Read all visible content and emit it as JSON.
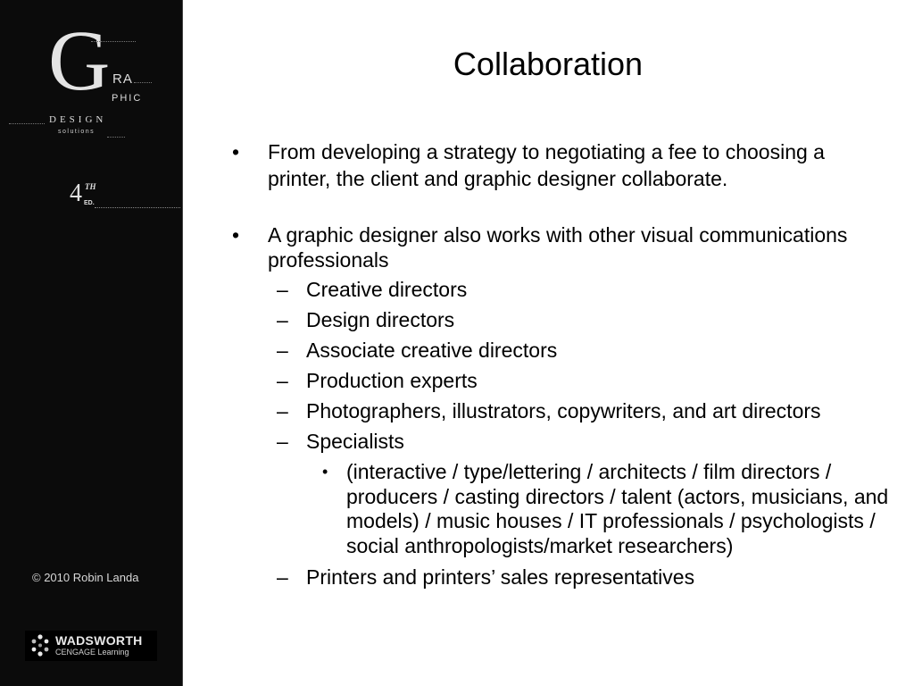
{
  "slide": {
    "title": "Collaboration",
    "bullets": [
      "From developing a strategy to negotiating a fee to choosing a printer, the client and graphic designer collaborate.",
      "A graphic designer also works with other visual communications professionals"
    ],
    "sub_items": [
      "Creative directors",
      "Design directors",
      "Associate creative directors",
      "Production experts",
      "Photographers, illustrators, copywriters, and art directors",
      "Specialists"
    ],
    "specialists_detail": "(interactive / type/lettering / architects / film directors / producers / casting directors / talent (actors, musicians, and models) / music houses / IT professionals / psychologists / social anthropologists/market researchers)",
    "last_sub_item": "Printers and printers’ sales representatives",
    "bullet_glyph": "•",
    "dash_glyph": "–"
  },
  "sidebar": {
    "logo": {
      "big_letter": "G",
      "ra": "RA",
      "phic": "PHIC",
      "design": "DESIGN",
      "solutions": "solutions"
    },
    "edition": {
      "number": "4",
      "suffix": "TH",
      "ed": "ED."
    },
    "copyright": "© 2010 Robin Landa",
    "publisher": {
      "name": "WADSWORTH",
      "sub": "CENGAGE Learning"
    }
  },
  "colors": {
    "sidebar_bg": "#0b0b0b",
    "slide_bg": "#ffffff",
    "text": "#000000",
    "sidebar_text": "#d8d8d8"
  }
}
